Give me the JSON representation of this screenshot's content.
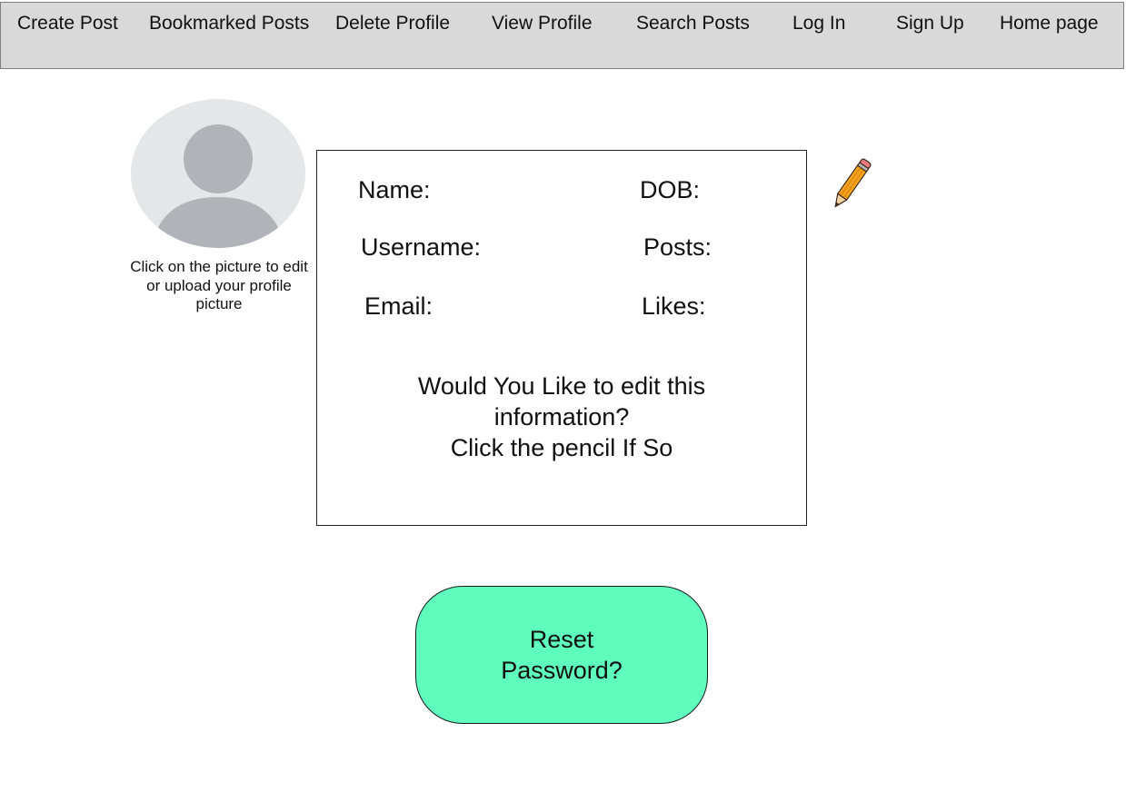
{
  "nav": {
    "items": [
      {
        "label": "Create Post"
      },
      {
        "label": "Bookmarked Posts"
      },
      {
        "label": "Delete Profile"
      },
      {
        "label": "View Profile"
      },
      {
        "label": "Search Posts"
      },
      {
        "label": "Log In"
      },
      {
        "label": "Sign Up"
      },
      {
        "label": "Home page"
      }
    ]
  },
  "profile": {
    "avatar_icon": "user-silhouette-icon",
    "caption": "Click on the picture to edit or upload your profile picture"
  },
  "info": {
    "name_label": "Name:",
    "dob_label": "DOB:",
    "username_label": "Username:",
    "posts_label": "Posts:",
    "email_label": "Email:",
    "likes_label": "Likes:",
    "prompt_line1": "Would You Like to edit this",
    "prompt_line2": "information?",
    "prompt_line3": "Click the pencil If So"
  },
  "edit": {
    "icon": "pencil-icon"
  },
  "reset": {
    "line1": "Reset",
    "line2": "Password?",
    "color": "#5efdbd"
  },
  "colors": {
    "navbar_bg": "#d9d9d9",
    "avatar_bg": "#e5e6e8",
    "avatar_figure": "#b0b3b7"
  }
}
